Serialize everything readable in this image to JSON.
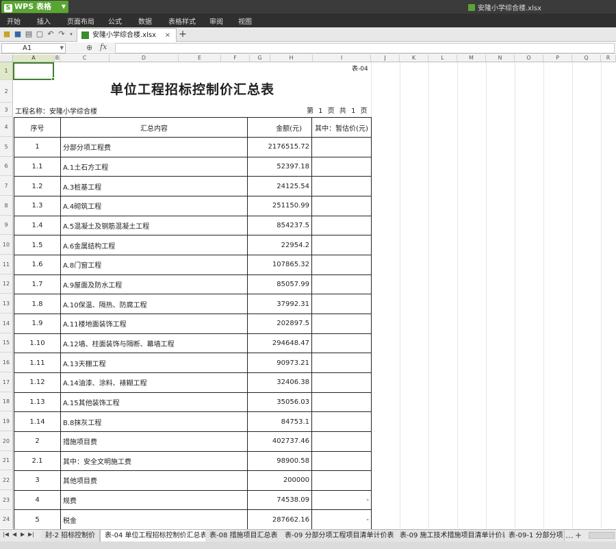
{
  "app": {
    "name": "WPS 表格",
    "document_title": "安隆小学综合楼.xlsx"
  },
  "menu": [
    "开始",
    "插入",
    "页面布局",
    "公式",
    "数据",
    "表格样式",
    "审阅",
    "视图"
  ],
  "doc_tab": {
    "label": "安隆小学综合楼.xlsx",
    "close": "×",
    "new": "+"
  },
  "formula_bar": {
    "cell_ref": "A1",
    "fx": "fx",
    "value": ""
  },
  "columns": [
    "A",
    "B",
    "C",
    "D",
    "E",
    "F",
    "G",
    "H",
    "I",
    "J",
    "K",
    "L",
    "M",
    "N",
    "O",
    "P",
    "Q",
    "R"
  ],
  "rows": [
    "1",
    "2",
    "3",
    "4",
    "5",
    "6",
    "7",
    "8",
    "9",
    "10",
    "11",
    "12",
    "13",
    "14",
    "15",
    "16",
    "17",
    "18",
    "19",
    "20",
    "21",
    "22",
    "23",
    "24"
  ],
  "sheet": {
    "table_no": "表-04",
    "title": "单位工程招标控制价汇总表",
    "project": "工程名称：安隆小学综合楼",
    "page": "第 1 页 共 1 页",
    "headers": {
      "no": "序号",
      "name": "汇总内容",
      "amount": "金额(元)",
      "estimate": "其中：暂估价(元)"
    },
    "rows": [
      {
        "no": "1",
        "name": "分部分项工程费",
        "amount": "2176515.72",
        "estimate": ""
      },
      {
        "no": "1.1",
        "name": "A.1土石方工程",
        "amount": "52397.18",
        "estimate": ""
      },
      {
        "no": "1.2",
        "name": "A.3桩基工程",
        "amount": "24125.54",
        "estimate": ""
      },
      {
        "no": "1.3",
        "name": "A.4砌筑工程",
        "amount": "251150.99",
        "estimate": ""
      },
      {
        "no": "1.4",
        "name": "A.5混凝土及钢筋混凝土工程",
        "amount": "854237.5",
        "estimate": ""
      },
      {
        "no": "1.5",
        "name": "A.6金属结构工程",
        "amount": "22954.2",
        "estimate": ""
      },
      {
        "no": "1.6",
        "name": "A.8门窗工程",
        "amount": "107865.32",
        "estimate": ""
      },
      {
        "no": "1.7",
        "name": "A.9屋面及防水工程",
        "amount": "85057.99",
        "estimate": ""
      },
      {
        "no": "1.8",
        "name": "A.10保温、隔热、防腐工程",
        "amount": "37992.31",
        "estimate": ""
      },
      {
        "no": "1.9",
        "name": "A.11楼地面装饰工程",
        "amount": "202897.5",
        "estimate": ""
      },
      {
        "no": "1.10",
        "name": "A.12墙、柱面装饰与隔断、幕墙工程",
        "amount": "294648.47",
        "estimate": ""
      },
      {
        "no": "1.11",
        "name": "A.13天棚工程",
        "amount": "90973.21",
        "estimate": ""
      },
      {
        "no": "1.12",
        "name": "A.14油漆、涂料、裱糊工程",
        "amount": "32406.38",
        "estimate": ""
      },
      {
        "no": "1.13",
        "name": "A.15其他装饰工程",
        "amount": "35056.03",
        "estimate": ""
      },
      {
        "no": "1.14",
        "name": "B.8抹灰工程",
        "amount": "84753.1",
        "estimate": ""
      },
      {
        "no": "2",
        "name": "措施项目费",
        "amount": "402737.46",
        "estimate": ""
      },
      {
        "no": "2.1",
        "name": "其中：安全文明施工费",
        "amount": "98900.58",
        "estimate": ""
      },
      {
        "no": "3",
        "name": "其他项目费",
        "amount": "200000",
        "estimate": ""
      },
      {
        "no": "4",
        "name": "规费",
        "amount": "74538.09",
        "estimate": "-"
      },
      {
        "no": "5",
        "name": "税金",
        "amount": "287662.16",
        "estimate": "-"
      }
    ]
  },
  "sheet_tabs": [
    {
      "label": "封-2 招标控制价",
      "active": false
    },
    {
      "label": "表-04 单位工程招标控制价汇总表",
      "active": true
    },
    {
      "label": "表-08 措施项目汇总表",
      "active": false
    },
    {
      "label": "表-09 分部分项工程项目清单计价表",
      "active": false
    },
    {
      "label": "表-09 施工技术措施项目清单计价表",
      "active": false
    },
    {
      "label": "表-09-1 分部分项",
      "active": false
    }
  ],
  "tab_nav": [
    "|◀",
    "◀",
    "▶",
    "▶|"
  ],
  "tab_controls": [
    "…",
    "+"
  ],
  "colors": {
    "app_green": "#5aa532",
    "selection_green": "#3f7f2a",
    "header_highlight": "#dfe9c8"
  }
}
